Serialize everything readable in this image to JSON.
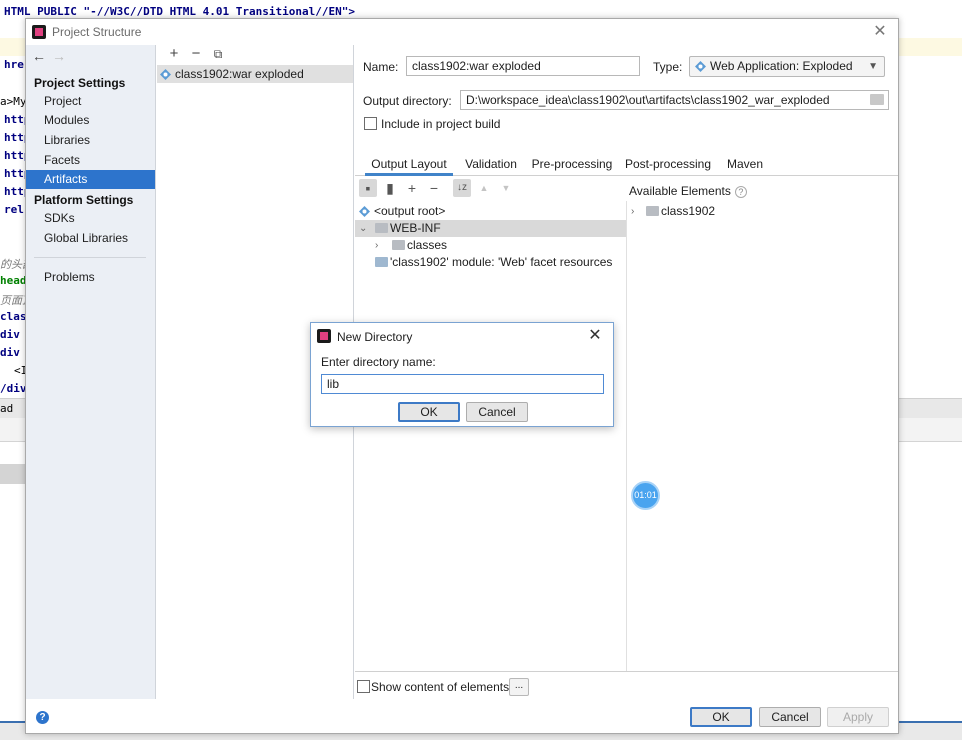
{
  "editor": {
    "line1": "HTML PUBLIC \"-//W3C//DTD HTML 4.01 Transitional//EN\">",
    "fragments": [
      "hre",
      "a>My",
      "http",
      "http",
      "http",
      "http",
      "http",
      "rel",
      "的头部",
      "heade",
      "页面顶",
      "class",
      "div c",
      "div c",
      "<I",
      "/div",
      "ad"
    ]
  },
  "project_structure": {
    "title": "Project Structure",
    "nav": {
      "back_icon": "arrow-left-icon",
      "forward_icon": "arrow-right-icon",
      "project_settings_header": "Project Settings",
      "project_settings_items": [
        "Project",
        "Modules",
        "Libraries",
        "Facets",
        "Artifacts"
      ],
      "platform_settings_header": "Platform Settings",
      "platform_settings_items": [
        "SDKs",
        "Global Libraries"
      ],
      "problems": "Problems",
      "selected": "Artifacts"
    },
    "artifacts_list": {
      "add": "+",
      "remove": "−",
      "copy": "⧉",
      "items": [
        "class1902:war exploded"
      ]
    },
    "detail": {
      "name_label": "Name:",
      "name_value": "class1902:war exploded",
      "type_label": "Type:",
      "type_value": "Web Application: Exploded",
      "output_dir_label": "Output directory:",
      "output_dir_value": "D:\\workspace_idea\\class1902\\out\\artifacts\\class1902_war_exploded",
      "include_in_build_label": "Include in project build",
      "include_in_build_checked": false,
      "tabs": [
        "Output Layout",
        "Validation",
        "Pre-processing",
        "Post-processing",
        "Maven"
      ],
      "active_tab": "Output Layout",
      "layout_tree": [
        {
          "label": "<output root>",
          "indent": 0
        },
        {
          "label": "WEB-INF",
          "indent": 1
        },
        {
          "label": "classes",
          "indent": 2
        },
        {
          "label": "'class1902' module: 'Web' facet resources",
          "indent": 1
        }
      ],
      "available_elements_title": "Available Elements",
      "available_help": "?",
      "available_tree": [
        "class1902"
      ],
      "show_content_label": "Show content of elements",
      "show_content_checked": false,
      "dots_label": "..."
    },
    "buttons": {
      "ok": "OK",
      "cancel": "Cancel",
      "apply": "Apply"
    }
  },
  "new_directory": {
    "title": "New Directory",
    "prompt": "Enter directory name:",
    "input_value": "lib",
    "ok": "OK",
    "cancel": "Cancel"
  },
  "timer_badge": "01:01",
  "colors": {
    "selection_blue": "#2d74cc",
    "left_panel_bg": "#ebeff5",
    "tab_underline": "#4083c9"
  }
}
